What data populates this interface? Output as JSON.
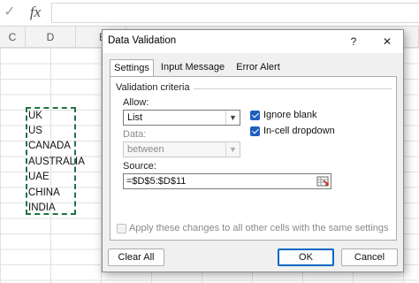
{
  "excel": {
    "cancel_icon": "✓",
    "fx_label": "fx",
    "columns": [
      "C",
      "D",
      "E"
    ],
    "cells": [
      "UK",
      "US",
      "CANADA",
      "AUSTRALIA",
      "UAE",
      "CHINA",
      "INDIA"
    ]
  },
  "dialog": {
    "title": "Data Validation",
    "help": "?",
    "close": "✕",
    "tabs": [
      {
        "label": "Settings",
        "active": true
      },
      {
        "label": "Input Message",
        "active": false
      },
      {
        "label": "Error Alert",
        "active": false
      }
    ],
    "group_title": "Validation criteria",
    "allow_label": "Allow:",
    "allow_value": "List",
    "data_label": "Data:",
    "data_value": "between",
    "ignore_blank_label": "Ignore blank",
    "ignore_blank_checked": true,
    "incell_dropdown_label": "In-cell dropdown",
    "incell_dropdown_checked": true,
    "source_label": "Source:",
    "source_value": "=$D$5:$D$11",
    "apply_all_label": "Apply these changes to all other cells with the same settings",
    "apply_all_checked": false,
    "clear_all_label": "Clear All",
    "ok_label": "OK",
    "cancel_label": "Cancel"
  },
  "colors": {
    "accent": "#1f5fbf",
    "copy_border": "#217346"
  }
}
